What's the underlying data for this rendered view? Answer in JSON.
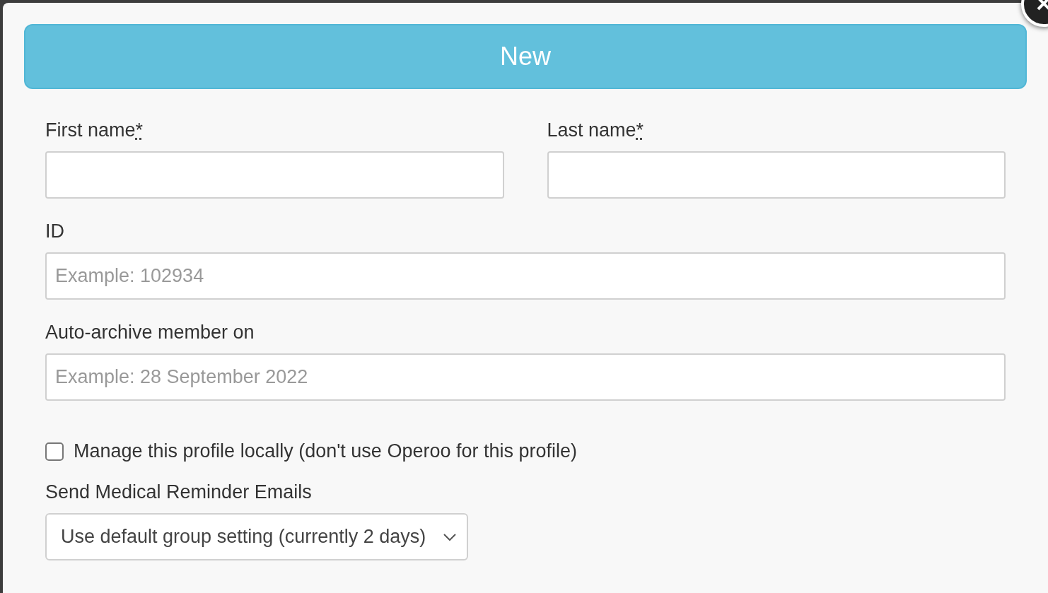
{
  "header_button": {
    "label": "New"
  },
  "name_fields": [
    {
      "label": "First name",
      "required_mark": "*"
    },
    {
      "label": "Last name",
      "required_mark": "*"
    }
  ],
  "id_field": {
    "label": "ID",
    "placeholder": "Example: 102934"
  },
  "archive_field": {
    "label": "Auto-archive member on",
    "placeholder": "Example: 28 September 2022"
  },
  "manage_locally": {
    "label": "Manage this profile locally (don't use Operoo for this profile)",
    "checked": false
  },
  "reminder": {
    "label": "Send Medical Reminder Emails",
    "value": "Use default group setting (currently 2 days)"
  }
}
